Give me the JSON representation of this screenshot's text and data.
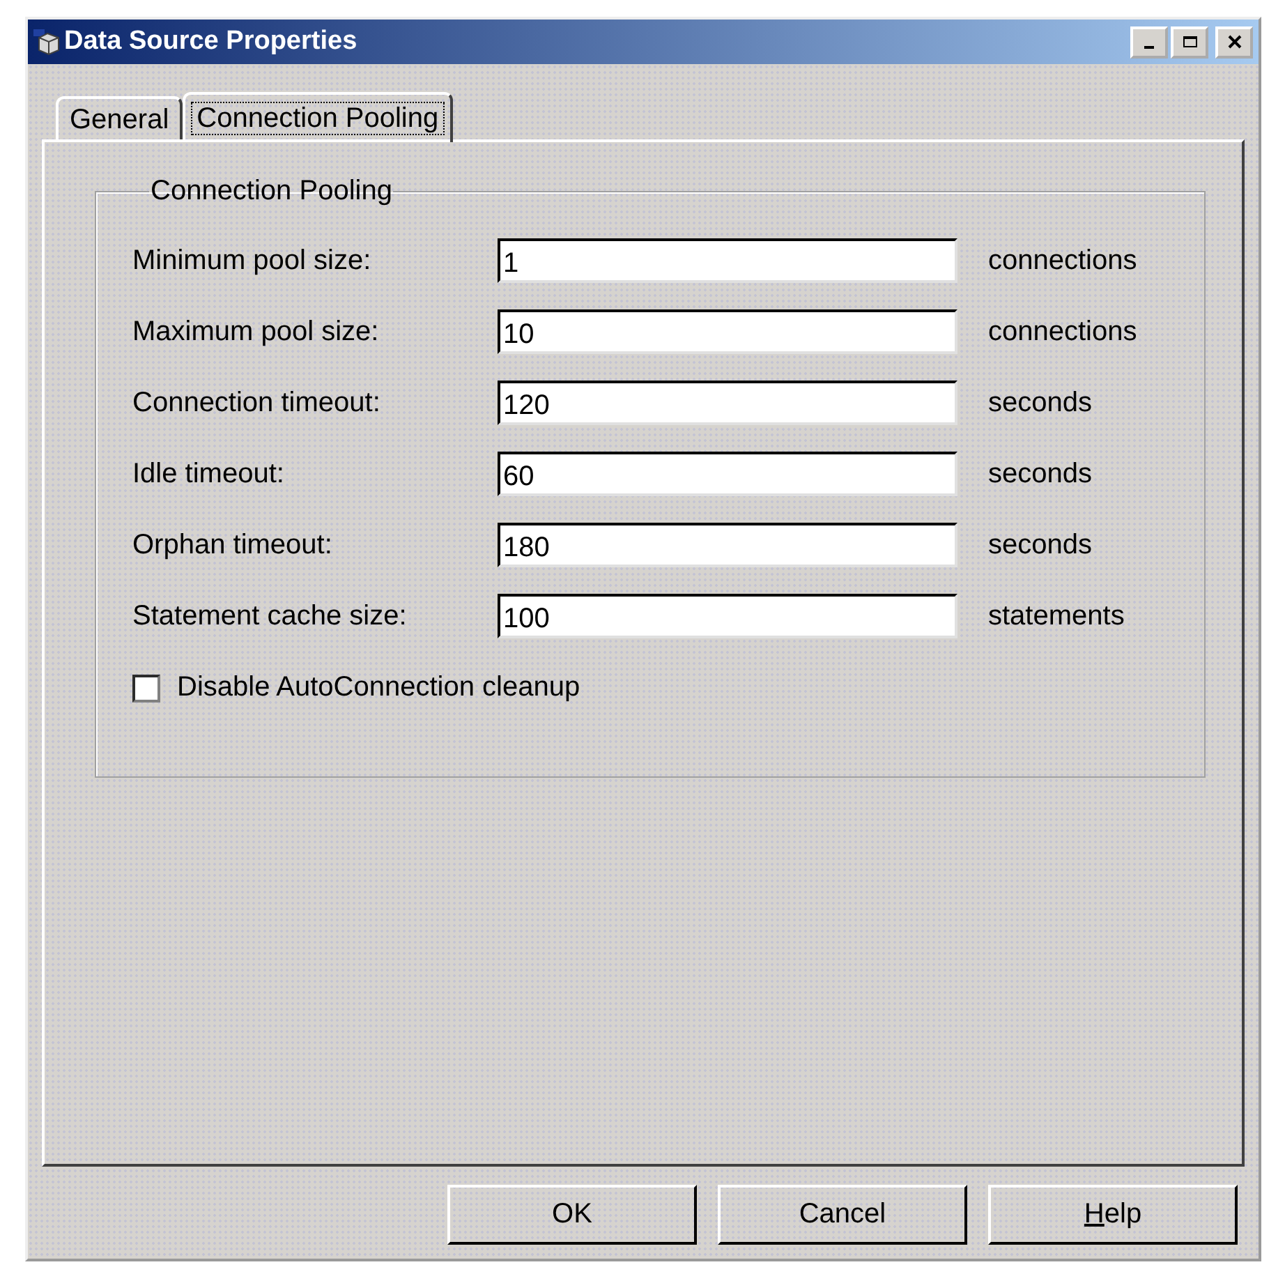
{
  "window": {
    "title": "Data Source Properties"
  },
  "tabs": [
    {
      "label": "General",
      "selected": false
    },
    {
      "label": "Connection Pooling",
      "selected": true
    }
  ],
  "group": {
    "title": "Connection Pooling"
  },
  "fields": [
    {
      "label": "Minimum pool size:",
      "value": "1",
      "unit": "connections"
    },
    {
      "label": "Maximum pool size:",
      "value": "10",
      "unit": "connections"
    },
    {
      "label": "Connection timeout:",
      "value": "120",
      "unit": "seconds"
    },
    {
      "label": "Idle timeout:",
      "value": "60",
      "unit": "seconds"
    },
    {
      "label": "Orphan timeout:",
      "value": "180",
      "unit": "seconds"
    },
    {
      "label": "Statement cache size:",
      "value": "100",
      "unit": "statements"
    }
  ],
  "checkbox": {
    "label": "Disable AutoConnection cleanup",
    "checked": false
  },
  "buttons": [
    {
      "label": "OK"
    },
    {
      "label": "Cancel"
    },
    {
      "label": "Help",
      "underline_first": true
    }
  ]
}
